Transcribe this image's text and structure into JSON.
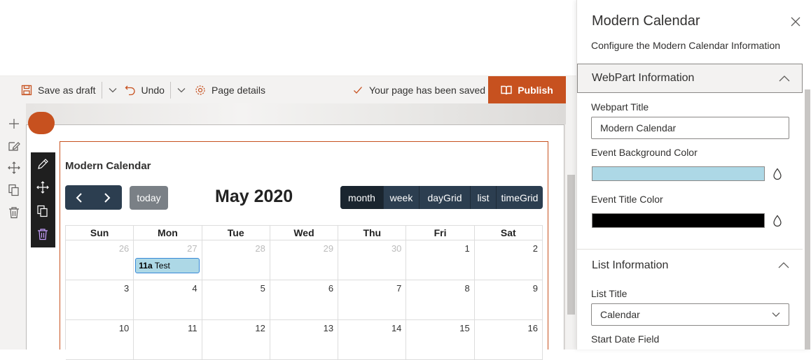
{
  "command_bar": {
    "save_draft_label": "Save as draft",
    "undo_label": "Undo",
    "page_details_label": "Page details",
    "saved_status": "Your page has been saved",
    "publish_label": "Publish"
  },
  "webpart": {
    "title": "Modern Calendar"
  },
  "calendar": {
    "title": "May 2020",
    "today_label": "today",
    "views": [
      {
        "label": "month",
        "active": true
      },
      {
        "label": "week",
        "active": false
      },
      {
        "label": "dayGrid",
        "active": false
      },
      {
        "label": "list",
        "active": false
      },
      {
        "label": "timeGrid",
        "active": false
      }
    ],
    "days_of_week": [
      "Sun",
      "Mon",
      "Tue",
      "Wed",
      "Thu",
      "Fri",
      "Sat"
    ],
    "weeks": [
      [
        {
          "num": "26",
          "other": true
        },
        {
          "num": "27",
          "other": true,
          "event_time": "11a",
          "event_title": "Test"
        },
        {
          "num": "28",
          "other": true
        },
        {
          "num": "29",
          "other": true
        },
        {
          "num": "30",
          "other": true
        },
        {
          "num": "1",
          "other": false
        },
        {
          "num": "2",
          "other": false
        }
      ],
      [
        {
          "num": "3",
          "other": false
        },
        {
          "num": "4",
          "other": false
        },
        {
          "num": "5",
          "other": false
        },
        {
          "num": "6",
          "other": false
        },
        {
          "num": "7",
          "other": false
        },
        {
          "num": "8",
          "other": false
        },
        {
          "num": "9",
          "other": false
        }
      ],
      [
        {
          "num": "10",
          "other": false
        },
        {
          "num": "11",
          "other": false
        },
        {
          "num": "12",
          "other": false
        },
        {
          "num": "13",
          "other": false
        },
        {
          "num": "14",
          "other": false
        },
        {
          "num": "15",
          "other": false
        },
        {
          "num": "16",
          "other": false
        }
      ]
    ]
  },
  "pane": {
    "title": "Modern Calendar",
    "description": "Configure the Modern Calendar Information",
    "group1_title": "WebPart Information",
    "webpart_title_label": "Webpart Title",
    "webpart_title_value": "Modern Calendar",
    "event_bg_label": "Event Background Color",
    "event_bg_color": "#add8e6",
    "event_title_color_label": "Event Title Color",
    "event_title_color": "#000000",
    "group2_title": "List Information",
    "list_title_label": "List Title",
    "list_title_value": "Calendar",
    "start_date_label": "Start Date Field"
  },
  "colors": {
    "accent": "#c7511f",
    "calendar_dark": "#2c3e50"
  }
}
